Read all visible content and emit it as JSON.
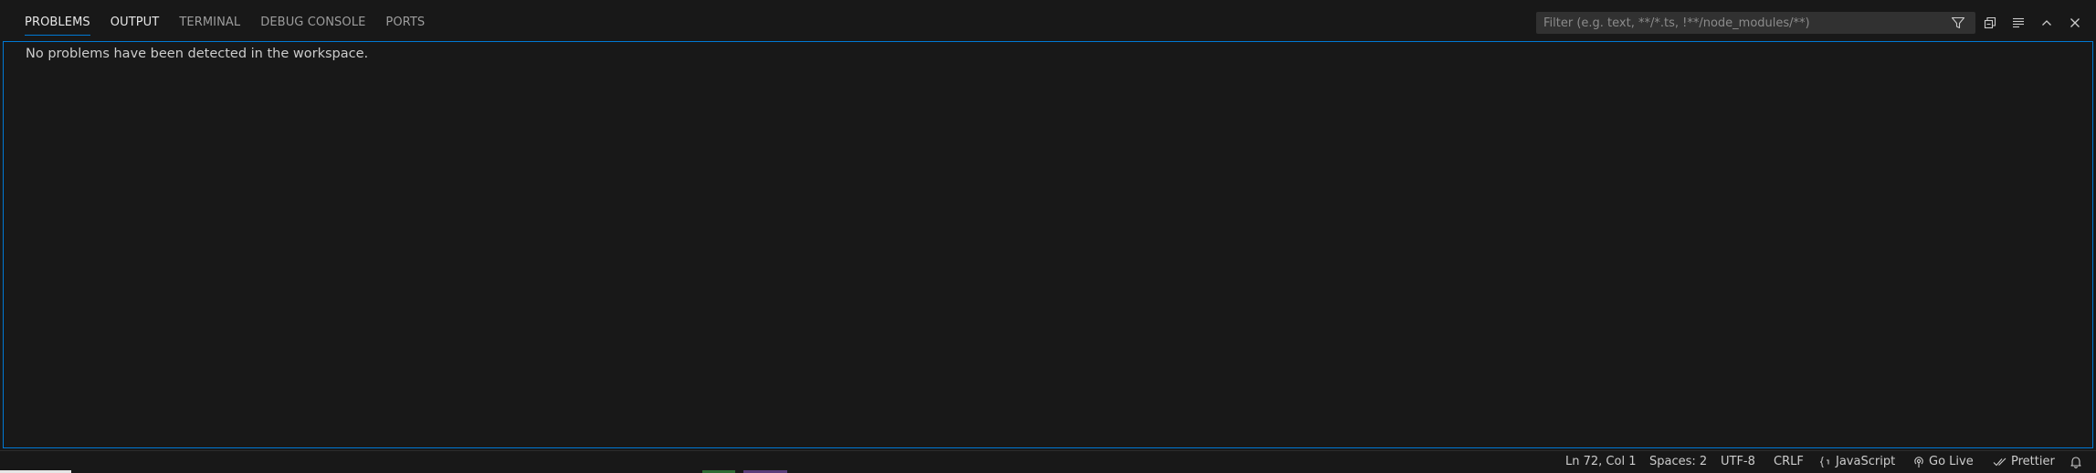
{
  "panel": {
    "tabs": [
      {
        "label": "PROBLEMS",
        "active": true
      },
      {
        "label": "OUTPUT",
        "active": false
      },
      {
        "label": "TERMINAL",
        "active": false
      },
      {
        "label": "DEBUG CONSOLE",
        "active": false
      },
      {
        "label": "PORTS",
        "active": false
      }
    ],
    "filter_placeholder": "Filter (e.g. text, **/*.ts, !**/node_modules/**)",
    "actions": {
      "filter": "filter-icon",
      "collapse_all": "collapse-all-icon",
      "view_as_list": "list-view-icon",
      "maximize": "chevron-up-icon",
      "close": "close-icon"
    }
  },
  "content": {
    "message": "No problems have been detected in the workspace."
  },
  "status_bar": {
    "cursor_position": "Ln 72, Col 1",
    "indentation": "Spaces: 2",
    "encoding": "UTF-8",
    "line_ending": "CRLF",
    "language": "JavaScript",
    "go_live": "Go Live",
    "prettier": "Prettier"
  },
  "colors": {
    "background": "#181818",
    "accent": "#0078d4",
    "text": "#cccccc",
    "muted_text": "#9d9d9d"
  }
}
